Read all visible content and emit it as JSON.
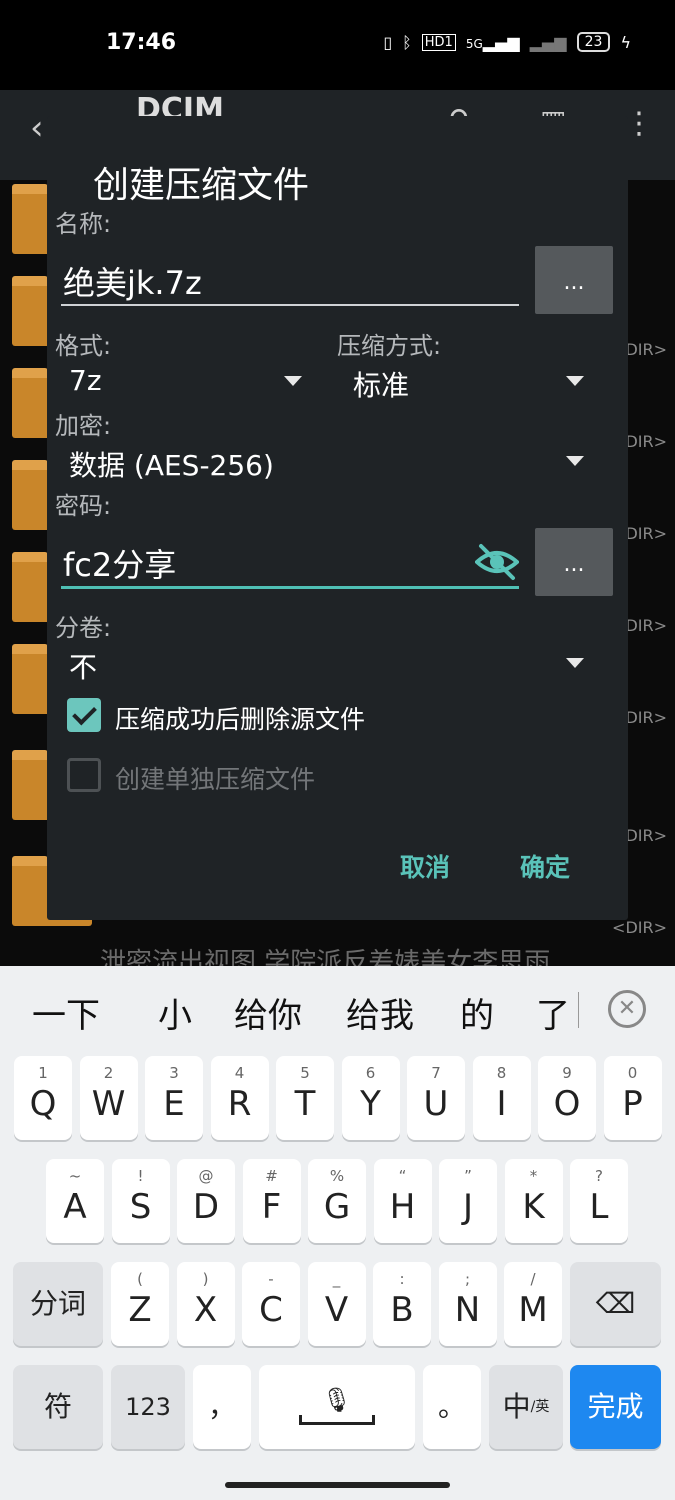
{
  "status_bar": {
    "time": "17:46",
    "icons": [
      "vibrate-icon",
      "bluetooth-icon",
      "hd-icon",
      "signal-5g-icon",
      "signal-icon"
    ],
    "hd_label": "HD1",
    "network_label": "5G",
    "battery": "23"
  },
  "background": {
    "title": "DCIM",
    "dir_label": "<DIR>",
    "behind_text": "泄密流出视图 学院派反差婊美女李思雨"
  },
  "dialog": {
    "title": "创建压缩文件",
    "name_label": "名称:",
    "name_value": "绝美jk.7z",
    "browse_button": "...",
    "format_label": "格式:",
    "format_value": "7z",
    "method_label": "压缩方式:",
    "method_value": "标准",
    "encrypt_label": "加密:",
    "encrypt_value": "数据 (AES-256)",
    "password_label": "密码:",
    "password_value": "fc2分享",
    "password_button": "...",
    "split_label": "分卷:",
    "split_value": "不",
    "delete_source_label": "压缩成功后删除源文件",
    "delete_source_checked": true,
    "separate_archive_label": "创建单独压缩文件",
    "separate_archive_checked": false,
    "cancel_button": "取消",
    "ok_button": "确定",
    "accent_color": "#5ac3b9"
  },
  "keyboard": {
    "candidates": [
      "一下",
      "小",
      "给你",
      "给我",
      "的",
      "了"
    ],
    "row1": [
      {
        "sub": "1",
        "key": "Q"
      },
      {
        "sub": "2",
        "key": "W"
      },
      {
        "sub": "3",
        "key": "E"
      },
      {
        "sub": "4",
        "key": "R"
      },
      {
        "sub": "5",
        "key": "T"
      },
      {
        "sub": "6",
        "key": "Y"
      },
      {
        "sub": "7",
        "key": "U"
      },
      {
        "sub": "8",
        "key": "I"
      },
      {
        "sub": "9",
        "key": "O"
      },
      {
        "sub": "0",
        "key": "P"
      }
    ],
    "row2": [
      {
        "sub": "~",
        "key": "A"
      },
      {
        "sub": "!",
        "key": "S"
      },
      {
        "sub": "@",
        "key": "D"
      },
      {
        "sub": "#",
        "key": "F"
      },
      {
        "sub": "%",
        "key": "G"
      },
      {
        "sub": "“",
        "key": "H"
      },
      {
        "sub": "”",
        "key": "J"
      },
      {
        "sub": "*",
        "key": "K"
      },
      {
        "sub": "?",
        "key": "L"
      }
    ],
    "row3": [
      {
        "sub": "(",
        "key": "Z"
      },
      {
        "sub": ")",
        "key": "X"
      },
      {
        "sub": "-",
        "key": "C"
      },
      {
        "sub": "_",
        "key": "V"
      },
      {
        "sub": ":",
        "key": "B"
      },
      {
        "sub": ";",
        "key": "N"
      },
      {
        "sub": "/",
        "key": "M"
      }
    ],
    "segment_key": "分词",
    "symbol_key": "符",
    "num_key": "123",
    "comma_key": "，",
    "period_key": "。",
    "lang_key": "中",
    "lang_sub": "/英",
    "done_key": "完成",
    "accent_color": "#1e88f0"
  }
}
